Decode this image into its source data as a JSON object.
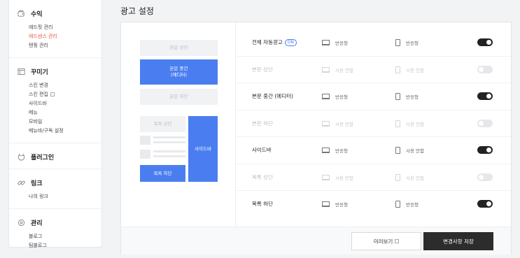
{
  "sidebar": {
    "sections": [
      {
        "icon": "revenue-icon",
        "title": "수익",
        "items": [
          "애드핏 관리",
          "애드센스 관리",
          "텐핑 관리"
        ]
      },
      {
        "icon": "layout-icon",
        "title": "꾸미기",
        "items": [
          "스킨 변경",
          "스킨 편집",
          "사이드바",
          "메뉴",
          "모바일",
          "메뉴바/구독 설정"
        ]
      },
      {
        "icon": "plugin-icon",
        "title": "플러그인",
        "items": []
      },
      {
        "icon": "link-icon",
        "title": "링크",
        "items": [
          "나의 링크"
        ]
      },
      {
        "icon": "settings-icon",
        "title": "관리",
        "items": [
          "블로그",
          "팀블로그"
        ]
      }
    ]
  },
  "page": {
    "title": "광고 설정"
  },
  "preview": {
    "body_top": "본문 상단",
    "body_middle_1": "본문 중간",
    "body_middle_2": "(에디터)",
    "body_bottom": "본문 하단",
    "list_top": "목록 상단",
    "sidebar": "사이드바",
    "list_bottom": "목록 하단"
  },
  "on_badge": "ON",
  "rows": [
    {
      "label": "전체 자동광고",
      "pc": "반응형",
      "mobile": "반응형",
      "enabled": true
    },
    {
      "label": "본문 상단",
      "pc": "사용 안함",
      "mobile": "사용 안함",
      "enabled": false
    },
    {
      "label": "본문 중간 (에디터)",
      "pc": "반응형",
      "mobile": "반응형",
      "enabled": true
    },
    {
      "label": "본문 하단",
      "pc": "사용 안함",
      "mobile": "사용 안함",
      "enabled": false
    },
    {
      "label": "사이드바",
      "pc": "반응형",
      "mobile": "사용 안함",
      "enabled": true
    },
    {
      "label": "목록 상단",
      "pc": "사용 안함",
      "mobile": "사용 안함",
      "enabled": false
    },
    {
      "label": "목록 하단",
      "pc": "반응형",
      "mobile": "반응형",
      "enabled": true
    }
  ],
  "footer": {
    "preview_label": "미리보기",
    "save_label": "변경사항 저장"
  },
  "colors": {
    "accent": "#4a7ef0",
    "active_link": "#f0543e",
    "toggle_on": "#222222",
    "toggle_off": "#e6e7ea"
  }
}
